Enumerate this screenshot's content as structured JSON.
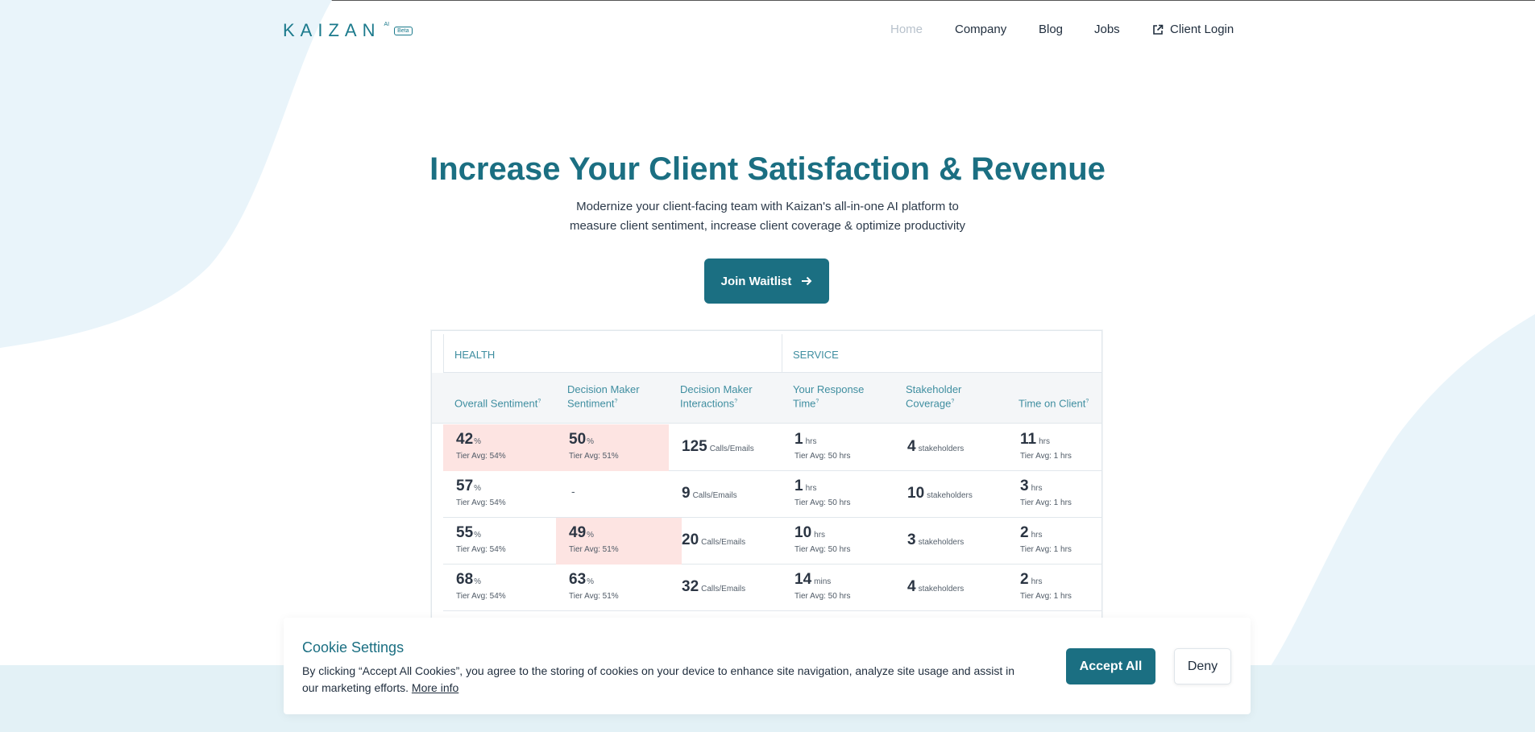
{
  "brand": {
    "name": "KAIZAN",
    "ai": "AI",
    "badge": "Beta"
  },
  "nav": {
    "home": "Home",
    "company": "Company",
    "blog": "Blog",
    "jobs": "Jobs",
    "client_login": "Client Login"
  },
  "hero": {
    "title": "Increase Your Client Satisfaction & Revenue",
    "subtitle_line1": "Modernize your client-facing team with Kaizan's all-in-one AI platform to",
    "subtitle_line2": "measure client sentiment, increase client coverage & optimize productivity",
    "cta_label": "Join Waitlist"
  },
  "table": {
    "groups": {
      "health": "HEALTH",
      "service": "SERVICE"
    },
    "columns": [
      {
        "line1": "Overall Sentiment",
        "line2": ""
      },
      {
        "line1": "Decision Maker",
        "line2": "Sentiment"
      },
      {
        "line1": "Decision Maker",
        "line2": "Interactions"
      },
      {
        "line1": "Your Response",
        "line2": "Time"
      },
      {
        "line1": "Stakeholder",
        "line2": "Coverage"
      },
      {
        "line1": "Time on Client",
        "line2": ""
      }
    ],
    "tooltip_mark": "?",
    "rows": [
      {
        "c0": {
          "value": "42",
          "unit": "%",
          "tier": "Tier Avg: 54%"
        },
        "c1": {
          "value": "50",
          "unit": "%",
          "tier": "Tier Avg: 51%"
        },
        "c2": {
          "value": "125",
          "unit": "Calls/Emails"
        },
        "c3": {
          "value": "1",
          "unit": "hrs",
          "tier": "Tier Avg: 50 hrs"
        },
        "c4": {
          "value": "4",
          "unit": "stakeholders"
        },
        "c5": {
          "value": "11",
          "unit": "hrs",
          "tier": "Tier Avg: 1 hrs"
        }
      },
      {
        "c0": {
          "value": "57",
          "unit": "%",
          "tier": "Tier Avg: 54%"
        },
        "c1": {
          "value": "-",
          "unit": "",
          "tier": ""
        },
        "c2": {
          "value": "9",
          "unit": "Calls/Emails"
        },
        "c3": {
          "value": "1",
          "unit": "hrs",
          "tier": "Tier Avg: 50 hrs"
        },
        "c4": {
          "value": "10",
          "unit": "stakeholders"
        },
        "c5": {
          "value": "3",
          "unit": "hrs",
          "tier": "Tier Avg: 1 hrs"
        }
      },
      {
        "c0": {
          "value": "55",
          "unit": "%",
          "tier": "Tier Avg: 54%"
        },
        "c1": {
          "value": "49",
          "unit": "%",
          "tier": "Tier Avg: 51%"
        },
        "c2": {
          "value": "20",
          "unit": "Calls/Emails"
        },
        "c3": {
          "value": "10",
          "unit": "hrs",
          "tier": "Tier Avg: 50 hrs"
        },
        "c4": {
          "value": "3",
          "unit": "stakeholders"
        },
        "c5": {
          "value": "2",
          "unit": "hrs",
          "tier": "Tier Avg: 1 hrs"
        }
      },
      {
        "c0": {
          "value": "68",
          "unit": "%",
          "tier": "Tier Avg: 54%"
        },
        "c1": {
          "value": "63",
          "unit": "%",
          "tier": "Tier Avg: 51%"
        },
        "c2": {
          "value": "32",
          "unit": "Calls/Emails"
        },
        "c3": {
          "value": "14",
          "unit": "mins",
          "tier": "Tier Avg: 50 hrs"
        },
        "c4": {
          "value": "4",
          "unit": "stakeholders"
        },
        "c5": {
          "value": "2",
          "unit": "hrs",
          "tier": "Tier Avg: 1 hrs"
        }
      }
    ]
  },
  "cookie": {
    "title": "Cookie Settings",
    "text": "By clicking “Accept All Cookies”, you agree to the storing of cookies on your device to enhance site navigation, analyze site usage and assist in our marketing efforts.",
    "more_info": "More info",
    "accept_label": "Accept All",
    "deny_label": "Deny"
  },
  "colors": {
    "brand": "#1b6f82",
    "alert_cell": "#fde4e2",
    "background_shape": "#e9f4fa"
  },
  "icons": {
    "login": "external-link-icon",
    "cta": "arrow-right-icon"
  }
}
